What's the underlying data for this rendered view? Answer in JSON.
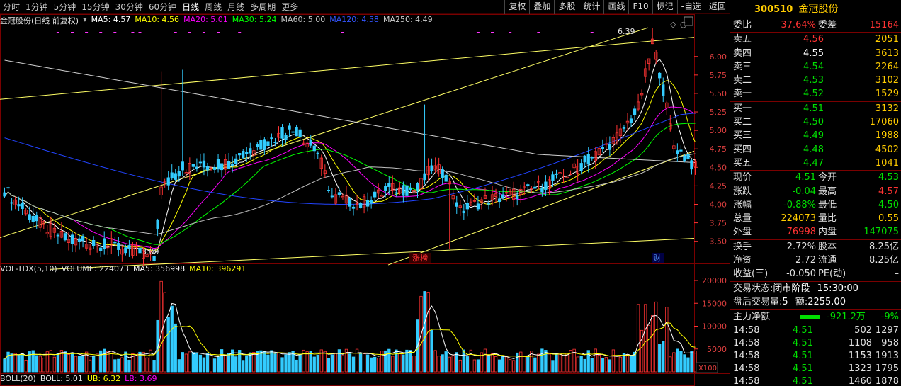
{
  "toolbar": {
    "tabs": [
      "分时",
      "1分钟",
      "5分钟",
      "15分钟",
      "30分钟",
      "60分钟",
      "日线",
      "周线",
      "月线",
      "多周期",
      "更多"
    ],
    "active_tab": "日线",
    "buttons": [
      "复权",
      "叠加",
      "多股",
      "统计",
      "画线",
      "F10",
      "标记",
      "-自选",
      "返回"
    ]
  },
  "chart_header": {
    "title": "金冠股份(日线 前复权)",
    "ma": [
      {
        "label": "MA5: 4.57",
        "color": "#ffffff"
      },
      {
        "label": "MA10: 4.56",
        "color": "#ffff00"
      },
      {
        "label": "MA20: 5.01",
        "color": "#ff00ff"
      },
      {
        "label": "MA30: 5.24",
        "color": "#00ff00"
      },
      {
        "label": "MA60: 5.00",
        "color": "#c0c0c0"
      },
      {
        "label": "MA120: 4.58",
        "color": "#3355ff"
      },
      {
        "label": "MA250: 4.49",
        "color": "#d0d0d0"
      }
    ]
  },
  "vol_header": {
    "title": "VOL-TDX(5,10)",
    "volume": "VOLUME: 224073",
    "ma5": "MA5: 356998",
    "ma10": "MA10: 396291"
  },
  "boll_header": {
    "title": "BOLL(20)",
    "boll": "BOLL: 5.01",
    "ub": "UB: 6.32",
    "lb": "LB: 3.69"
  },
  "annotations": {
    "high_label": "6.39",
    "low_label": "3.09",
    "limit_up_marker": "涨榜",
    "finance_marker": "财",
    "vol_unit": "X100"
  },
  "chart_data": {
    "type": "candlestick",
    "price_axis": {
      "ticks": [
        6.0,
        5.75,
        5.5,
        5.25,
        5.0,
        4.75,
        4.5,
        4.25,
        4.0,
        3.75,
        3.5
      ],
      "range": [
        3.2,
        6.4
      ]
    },
    "volume_axis": {
      "ticks": [
        20000,
        15000,
        10000,
        5000
      ],
      "range": [
        0,
        20000
      ]
    },
    "volume_unit": "X100",
    "high": 6.39,
    "low": 3.09
  },
  "quote": {
    "code": "300510",
    "name": "金冠股份",
    "webi_label": "委比",
    "webi_value": "37.64%",
    "wecha_label": "委差",
    "wecha_value": "15164",
    "asks": [
      {
        "label": "卖五",
        "price": "4.56",
        "qty": "2051",
        "color": "#ff3333"
      },
      {
        "label": "卖四",
        "price": "4.55",
        "qty": "3613",
        "color": "#ffffff"
      },
      {
        "label": "卖三",
        "price": "4.54",
        "qty": "2264",
        "color": "#00e000"
      },
      {
        "label": "卖二",
        "price": "4.53",
        "qty": "3102",
        "color": "#00e000"
      },
      {
        "label": "卖一",
        "price": "4.52",
        "qty": "1529",
        "color": "#00e000"
      }
    ],
    "bids": [
      {
        "label": "买一",
        "price": "4.51",
        "qty": "3132",
        "color": "#00e000"
      },
      {
        "label": "买二",
        "price": "4.50",
        "qty": "17060",
        "color": "#00e000"
      },
      {
        "label": "买三",
        "price": "4.49",
        "qty": "1988",
        "color": "#00e000"
      },
      {
        "label": "买四",
        "price": "4.48",
        "qty": "4502",
        "color": "#00e000"
      },
      {
        "label": "买五",
        "price": "4.47",
        "qty": "1041",
        "color": "#00e000"
      }
    ],
    "stats": [
      {
        "l1": "现价",
        "v1": "4.51",
        "c1": "#00e000",
        "l2": "今开",
        "v2": "4.53",
        "c2": "#00e000"
      },
      {
        "l1": "涨跌",
        "v1": "-0.04",
        "c1": "#00e000",
        "l2": "最高",
        "v2": "4.57",
        "c2": "#ff3333"
      },
      {
        "l1": "涨幅",
        "v1": "-0.88%",
        "c1": "#00e000",
        "l2": "最低",
        "v2": "4.50",
        "c2": "#00e000"
      },
      {
        "l1": "总量",
        "v1": "224073",
        "c1": "#ffcc00",
        "l2": "量比",
        "v2": "0.55",
        "c2": "#ffcc00"
      },
      {
        "l1": "外盘",
        "v1": "76998",
        "c1": "#ff3333",
        "l2": "内盘",
        "v2": "147075",
        "c2": "#00e000"
      }
    ],
    "stats2": [
      {
        "l1": "换手",
        "v1": "2.72%",
        "c1": "#e0e0e0",
        "l2": "股本",
        "v2": "8.25亿",
        "c2": "#e0e0e0"
      },
      {
        "l1": "净资",
        "v1": "2.72",
        "c1": "#e0e0e0",
        "l2": "流通",
        "v2": "8.25亿",
        "c2": "#e0e0e0"
      },
      {
        "l1": "收益(三)",
        "v1": "-0.050",
        "c1": "#e0e0e0",
        "l2": "PE(动)",
        "v2": "–",
        "c2": "#e0e0e0"
      }
    ],
    "trade_status_label": "交易状态:",
    "trade_status": "闭市阶段",
    "trade_time": "15:30:00",
    "after_label": "盘后交易量:",
    "after_vol": "5",
    "after_amt_label": "额:",
    "after_amt": "2255.00",
    "flow_label": "主力净额",
    "flow_value": "-921.2万",
    "flow_pct": "-9%",
    "ticks": [
      {
        "t": "14:58",
        "p": "4.51",
        "v": "502",
        "n": "1297"
      },
      {
        "t": "14:58",
        "p": "4.51",
        "v": "1108",
        "n": "958"
      },
      {
        "t": "14:58",
        "p": "4.51",
        "v": "1153",
        "n": "1913"
      },
      {
        "t": "14:58",
        "p": "4.51",
        "v": "1323",
        "n": "1795"
      },
      {
        "t": "14:58",
        "p": "4.51",
        "v": "1460",
        "n": "1878"
      }
    ]
  }
}
